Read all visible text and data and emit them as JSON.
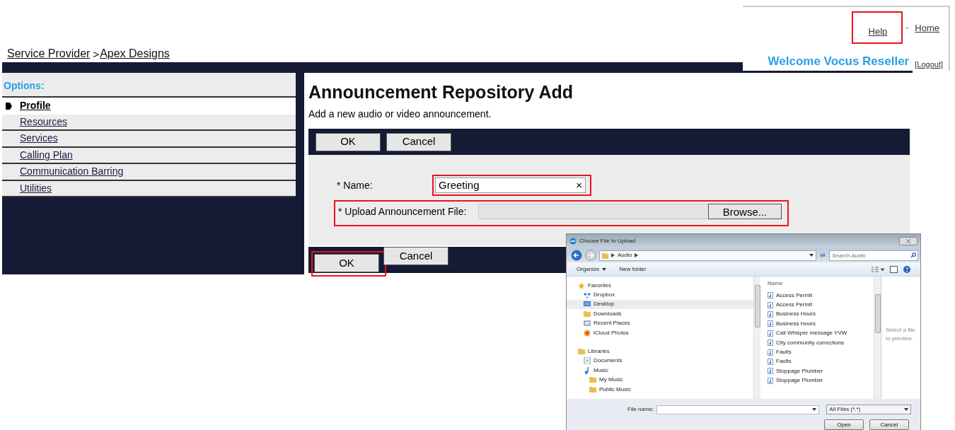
{
  "header": {
    "links": [
      {
        "label": "Help",
        "highlighted": true
      },
      {
        "label": "Home",
        "highlighted": false
      }
    ],
    "separator": "-",
    "welcome": "Welcome Vocus Reseller",
    "logout": "[Logout]"
  },
  "breadcrumb": {
    "items": [
      "Service Provider",
      "Apex Designs"
    ],
    "separator": ">"
  },
  "sidebar": {
    "title": "Options:",
    "items": [
      {
        "label": "Profile",
        "selected": true
      },
      {
        "label": "Resources",
        "selected": false
      },
      {
        "label": "Services",
        "selected": false
      },
      {
        "label": "Calling Plan",
        "selected": false
      },
      {
        "label": "Communication Barring",
        "selected": false
      },
      {
        "label": "Utilities",
        "selected": false
      }
    ]
  },
  "page": {
    "title": "Announcement Repository Add",
    "description": "Add a new audio or video announcement.",
    "top_buttons": [
      {
        "label": "OK",
        "highlighted": false
      },
      {
        "label": "Cancel",
        "highlighted": false
      }
    ],
    "fields": [
      {
        "kind": "text",
        "label": "* Name:",
        "value": "Greeting",
        "clear": "×",
        "highlighted": true
      },
      {
        "kind": "file",
        "label": "* Upload Announcement File:",
        "button": "Browse...",
        "highlighted": true
      }
    ],
    "bottom_buttons": [
      {
        "label": "OK",
        "highlighted": true
      },
      {
        "label": "Cancel",
        "highlighted": false
      }
    ]
  },
  "dialog": {
    "title": "Choose File to Upload",
    "path": [
      "Audio"
    ],
    "search_placeholder": "Search Audio",
    "toolbar": [
      "Organize",
      "New folder"
    ],
    "nav": [
      {
        "label": "Favorites",
        "kind": "star",
        "selected": false,
        "children": [
          {
            "label": "Dropbox",
            "kind": "cloud",
            "selected": false
          },
          {
            "label": "Desktop",
            "kind": "desktop",
            "selected": true
          },
          {
            "label": "Downloads",
            "kind": "folder",
            "selected": false
          },
          {
            "label": "Recent Places",
            "kind": "places",
            "selected": false
          },
          {
            "label": "iCloud Photos",
            "kind": "photos",
            "selected": false
          }
        ]
      },
      {
        "label": "Libraries",
        "kind": "folder",
        "selected": false,
        "children": [
          {
            "label": "Documents",
            "kind": "document",
            "selected": false
          },
          {
            "label": "Music",
            "kind": "music",
            "selected": false,
            "children": [
              {
                "label": "My Music",
                "kind": "folder",
                "selected": false
              },
              {
                "label": "Public Music",
                "kind": "folder",
                "selected": false
              }
            ]
          }
        ]
      }
    ],
    "list_header": "Name",
    "files": [
      "Access Permit",
      "Access Permit",
      "Business Hours",
      "Business Hours",
      "Call Whisper message YVW",
      "City community corrections",
      "Faults",
      "Faults",
      "Stoppage Plumber",
      "Stoppage Plumber"
    ],
    "preview_hint": "Select a file to preview.",
    "file_name_label": "File name:",
    "file_type": "All Files (*.*)",
    "buttons": [
      "Open",
      "Cancel"
    ]
  }
}
